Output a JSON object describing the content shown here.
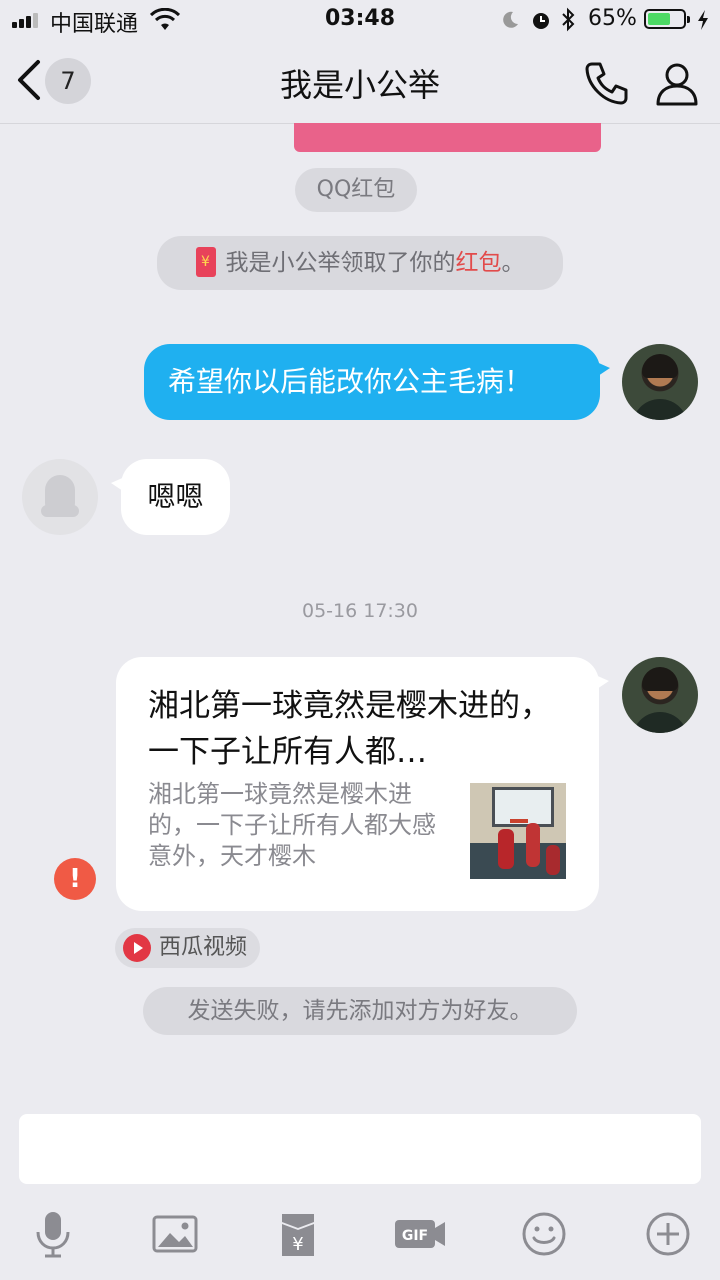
{
  "status_bar": {
    "carrier": "中国联通",
    "time": "03:48",
    "battery": "65%",
    "battery_level": 0.65
  },
  "nav": {
    "back_count": "7",
    "title": "我是小公举",
    "call_icon": "phone-icon",
    "profile_icon": "person-icon"
  },
  "chat": {
    "qq_redpacket_chip": "QQ红包",
    "redpacket_notice": {
      "prefix": "我是小公举领取了你的",
      "highlight": "红包",
      "suffix": "。"
    },
    "messages": [
      {
        "from": "me",
        "text": "希望你以后能改你公主毛病！"
      },
      {
        "from": "friend",
        "text": "嗯嗯"
      }
    ],
    "timestamp": "05-16 17:30",
    "share_card": {
      "title": "湘北第一球竟然是樱木进的，一下子让所有人都…",
      "description": "湘北第一球竟然是樱木进的，一下子让所有人都大感意外，天才樱木",
      "status": "error"
    },
    "source": {
      "label": "西瓜视频",
      "icon": "play-icon"
    },
    "fail_notice": "发送失败，请先添加对方为好友。"
  },
  "input": {
    "value": "",
    "placeholder": ""
  },
  "toolbar": {
    "icons": [
      "microphone-icon",
      "image-icon",
      "red-packet-icon",
      "gif-icon",
      "emoji-icon",
      "plus-icon"
    ]
  },
  "colors": {
    "background": "#ebebf0",
    "bubble_me": "#1fb0f0",
    "bubble_friend": "#ffffff",
    "highlight_red": "#e24b4b",
    "error": "#f05a45"
  }
}
